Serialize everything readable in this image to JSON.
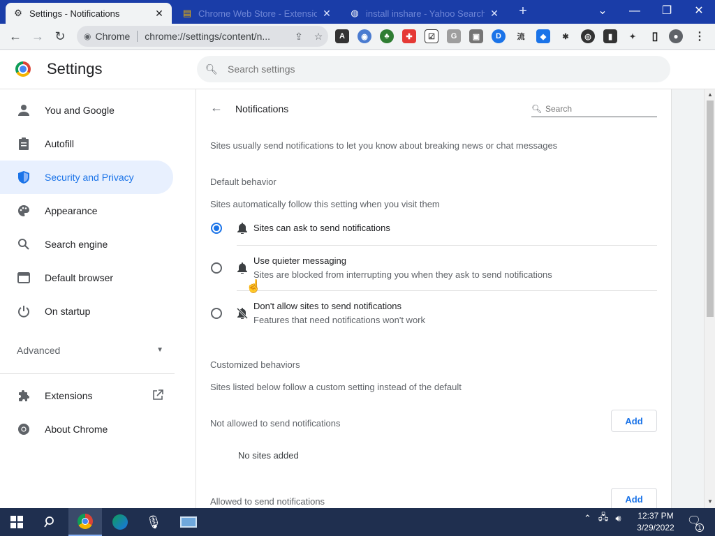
{
  "window": {
    "tabs": [
      {
        "label": "Settings - Notifications",
        "icon": "gear-icon"
      },
      {
        "label": "Chrome Web Store - Extensions",
        "icon": "webstore-icon"
      },
      {
        "label": "install inshare - Yahoo Search",
        "icon": "globe-icon"
      }
    ],
    "new_tab": "+",
    "controls": {
      "dropdown": "⌄",
      "minimize": "—",
      "restore": "❐",
      "close": "✕"
    }
  },
  "toolbar": {
    "chip": "Chrome",
    "url": "chrome://settings/content/n...",
    "extensions": [
      "A",
      "◉",
      "♣",
      "✚",
      "☑",
      "G",
      "▣",
      "D",
      "流",
      "◆",
      "✱",
      "◎",
      "▮",
      "✦"
    ]
  },
  "header": {
    "title": "Settings",
    "search_placeholder": "Search settings"
  },
  "sidebar": {
    "items": [
      {
        "label": "You and Google",
        "icon": "person-icon"
      },
      {
        "label": "Autofill",
        "icon": "clipboard-icon"
      },
      {
        "label": "Security and Privacy",
        "icon": "shield-icon"
      },
      {
        "label": "Appearance",
        "icon": "palette-icon"
      },
      {
        "label": "Search engine",
        "icon": "search-icon"
      },
      {
        "label": "Default browser",
        "icon": "browser-icon"
      },
      {
        "label": "On startup",
        "icon": "power-icon"
      }
    ],
    "advanced": "Advanced",
    "extensions": "Extensions",
    "about": "About Chrome"
  },
  "main": {
    "title": "Notifications",
    "search_placeholder": "Search",
    "intro": "Sites usually send notifications to let you know about breaking news or chat messages",
    "default_heading": "Default behavior",
    "default_desc": "Sites automatically follow this setting when you visit them",
    "options": [
      {
        "label": "Sites can ask to send notifications",
        "sub": "",
        "checked": true
      },
      {
        "label": "Use quieter messaging",
        "sub": "Sites are blocked from interrupting you when they ask to send notifications",
        "checked": false
      },
      {
        "label": "Don't allow sites to send notifications",
        "sub": "Features that need notifications won't work",
        "checked": false
      }
    ],
    "custom_heading": "Customized behaviors",
    "custom_desc": "Sites listed below follow a custom setting instead of the default",
    "not_allowed": "Not allowed to send notifications",
    "no_sites": "No sites added",
    "allowed": "Allowed to send notifications",
    "add_label": "Add"
  },
  "taskbar": {
    "time": "12:37 PM",
    "date": "3/29/2022",
    "notification_count": "1"
  }
}
